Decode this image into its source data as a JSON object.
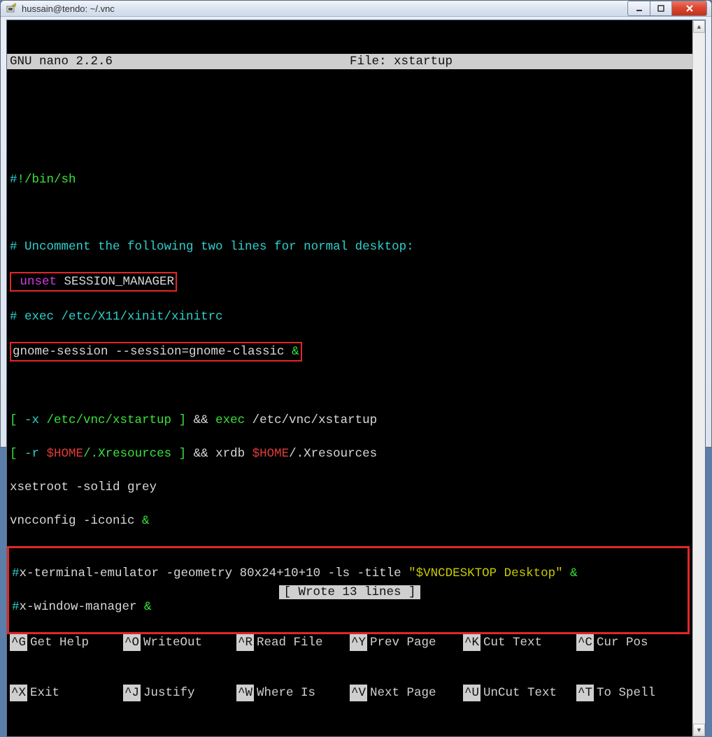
{
  "window": {
    "title": "hussain@tendo: ~/.vnc"
  },
  "nano": {
    "app": "GNU nano 2.2.6",
    "file_label": "File: xstartup",
    "status": "[ Wrote 13 lines ]"
  },
  "file": {
    "l1_hash": "#",
    "l1_shebang": "!/bin/sh",
    "l3_comment": "# Uncomment the following two lines for normal desktop:",
    "l4_pre": " ",
    "l4_unset": "unset",
    "l4_rest": " SESSION_MANAGER",
    "l5_comment": "# exec /etc/X11/xinit/xinitrc",
    "l6_text": "gnome-session --session=gnome-classic ",
    "l6_amp": "&",
    "l8_a": "[ ",
    "l8_b": "-x",
    "l8_c": " /etc/vnc/xstartup ",
    "l8_d": "]",
    "l8_e": " && ",
    "l8_f": "exec",
    "l8_g": " /etc/vnc/xstartup",
    "l9_a": "[ ",
    "l9_b": "-r",
    "l9_c": " ",
    "l9_home": "$HOME",
    "l9_d": "/.Xresources ",
    "l9_e": "]",
    "l9_f": " && xrdb ",
    "l9_g": "/.Xresources",
    "l10": "xsetroot -solid grey",
    "l11_a": "vncconfig -iconic ",
    "l11_amp": "&",
    "l12_hash": "#",
    "l12_a": "x-terminal-emulator -geometry 80x24+10+10 -ls -title ",
    "l12_q": "\"$VNCDESKTOP Desktop\"",
    "l12_sp": " ",
    "l12_amp": "&",
    "l13_hash": "#",
    "l13_a": "x-window-manager ",
    "l13_amp": "&"
  },
  "help": {
    "r1": [
      {
        "k": "^G",
        "l": "Get Help"
      },
      {
        "k": "^O",
        "l": "WriteOut"
      },
      {
        "k": "^R",
        "l": "Read File"
      },
      {
        "k": "^Y",
        "l": "Prev Page"
      },
      {
        "k": "^K",
        "l": "Cut Text"
      },
      {
        "k": "^C",
        "l": "Cur Pos"
      }
    ],
    "r2": [
      {
        "k": "^X",
        "l": "Exit"
      },
      {
        "k": "^J",
        "l": "Justify"
      },
      {
        "k": "^W",
        "l": "Where Is"
      },
      {
        "k": "^V",
        "l": "Next Page"
      },
      {
        "k": "^U",
        "l": "UnCut Text"
      },
      {
        "k": "^T",
        "l": "To Spell"
      }
    ]
  }
}
